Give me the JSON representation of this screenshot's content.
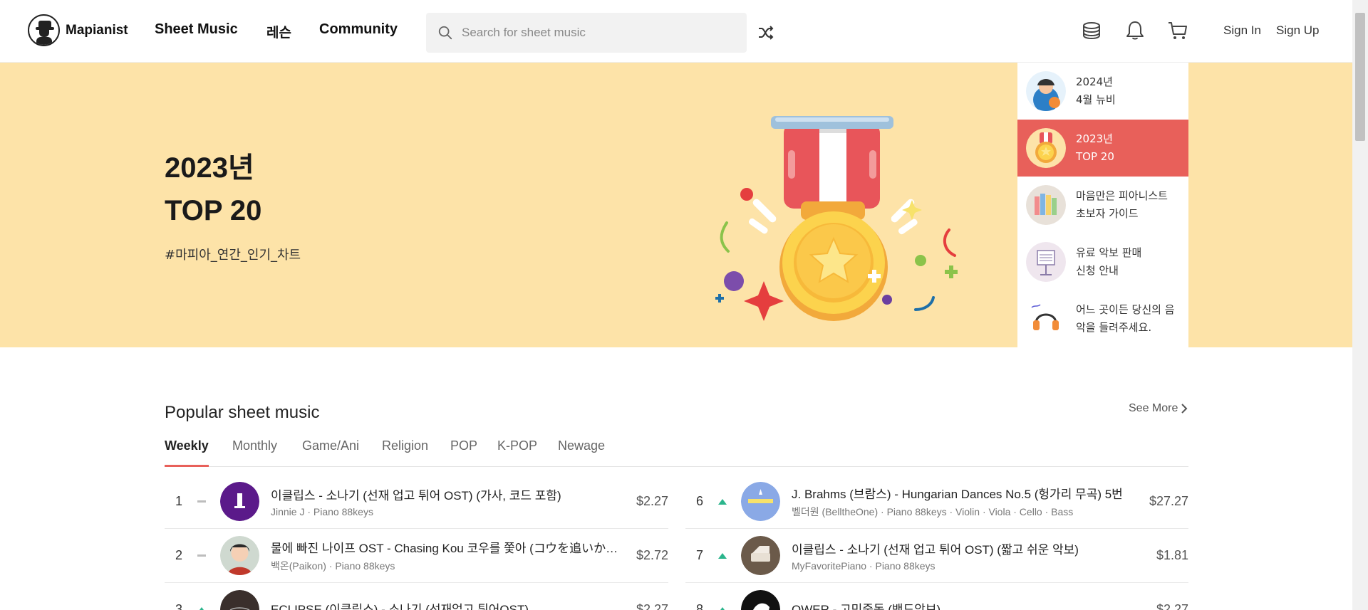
{
  "header": {
    "brand": "Mapianist",
    "nav": {
      "sheet_music": "Sheet Music",
      "lesson": "레슨",
      "community": "Community"
    },
    "search_placeholder": "Search for sheet music",
    "sign_in": "Sign In",
    "sign_up": "Sign Up"
  },
  "hero": {
    "title_line1": "2023년",
    "title_line2": "TOP 20",
    "tag": "#마피아_연간_인기_차트",
    "side_items": [
      {
        "line1": "2024년",
        "line2": "4월 뉴비",
        "active": false
      },
      {
        "line1": "2023년",
        "line2": "TOP 20",
        "active": true
      },
      {
        "line1": "마음만은 피아니스트",
        "line2": "초보자 가이드",
        "active": false
      },
      {
        "line1": "유료 악보 판매",
        "line2": "신청 안내",
        "active": false
      },
      {
        "line1": "어느 곳이든 당신의 음",
        "line2": "악을 들려주세요.",
        "active": false
      }
    ]
  },
  "popular": {
    "title": "Popular sheet music",
    "see_more": "See More",
    "tabs": [
      "Weekly",
      "Monthly",
      "Game/Ani",
      "Religion",
      "POP",
      "K-POP",
      "Newage"
    ],
    "active_tab": "Weekly",
    "rows": [
      {
        "rank": "1",
        "trend": "same",
        "title": "이클립스 - 소나기 (선재 업고 튀어 OST) (가사, 코드 포함)",
        "meta": "Jinnie J · Piano 88keys",
        "price": "$2.27"
      },
      {
        "rank": "2",
        "trend": "same",
        "title": "물에 빠진 나이프 OST - Chasing Kou 코우를 쫓아 (コウを追いかけて)",
        "meta": "백온(Paikon) · Piano 88keys",
        "price": "$2.72"
      },
      {
        "rank": "3",
        "trend": "up",
        "title": "ECLIPSE (이클립스) - 소나기 (선재업고 튀어OST)",
        "meta": "",
        "price": "$2.27"
      },
      {
        "rank": "6",
        "trend": "up",
        "title": "J. Brahms (브람스) - Hungarian Dances No.5 (헝가리 무곡) 5번",
        "meta": "벨더원 (BelltheOne) · Piano 88keys · Violin · Viola · Cello · Bass",
        "price": "$27.27"
      },
      {
        "rank": "7",
        "trend": "up",
        "title": "이클립스 - 소나기 (선재 업고 튀어 OST) (짧고 쉬운 악보)",
        "meta": "MyFavoritePiano · Piano 88keys",
        "price": "$1.81"
      },
      {
        "rank": "8",
        "trend": "up",
        "title": "QWER - 고민중독 (밴드악보)",
        "meta": "",
        "price": "$2.27"
      }
    ]
  },
  "colors": {
    "accent": "#e8605a",
    "hero_bg": "#fde3a8",
    "trend_up": "#2bb58c",
    "trend_same": "#bdbdbd"
  },
  "icons": [
    "search-icon",
    "shuffle-icon",
    "coin-icon",
    "bell-icon",
    "cart-icon",
    "chevron-right-icon"
  ]
}
